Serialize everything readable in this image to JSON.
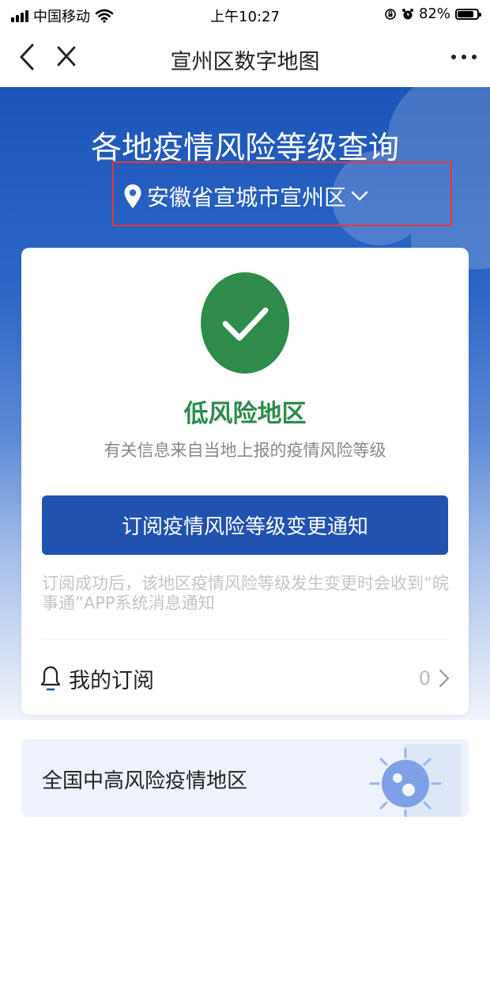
{
  "status_bar": {
    "carrier": "中国移动",
    "time": "上午10:27",
    "battery": "82%",
    "battery_level": 0.82,
    "icons": [
      "signal-icon",
      "wifi-icon",
      "orientation-lock-icon",
      "alarm-icon",
      "battery-icon"
    ]
  },
  "nav": {
    "title": "宣州区数字地图",
    "icons": [
      "back-icon",
      "close-icon",
      "more-icon"
    ]
  },
  "hero": {
    "title": "各地疫情风险等级查询",
    "location": "安徽省宣城市宣州区"
  },
  "card": {
    "risk_level": "低风险地区",
    "source_note": "有关信息来自当地上报的疫情风险等级",
    "subscribe_button": "订阅疫情风险等级变更通知",
    "subscribe_note": "订阅成功后，该地区疫情风险等级发生变更时会收到“皖事通”APP系统消息通知",
    "my_subscription_label": "我的订阅",
    "my_subscription_count": "0"
  },
  "national": {
    "label": "全国中高风险疫情地区"
  },
  "colors": {
    "primary": "#2152b0",
    "success": "#2e8b4b",
    "annotation": "#e53935"
  }
}
